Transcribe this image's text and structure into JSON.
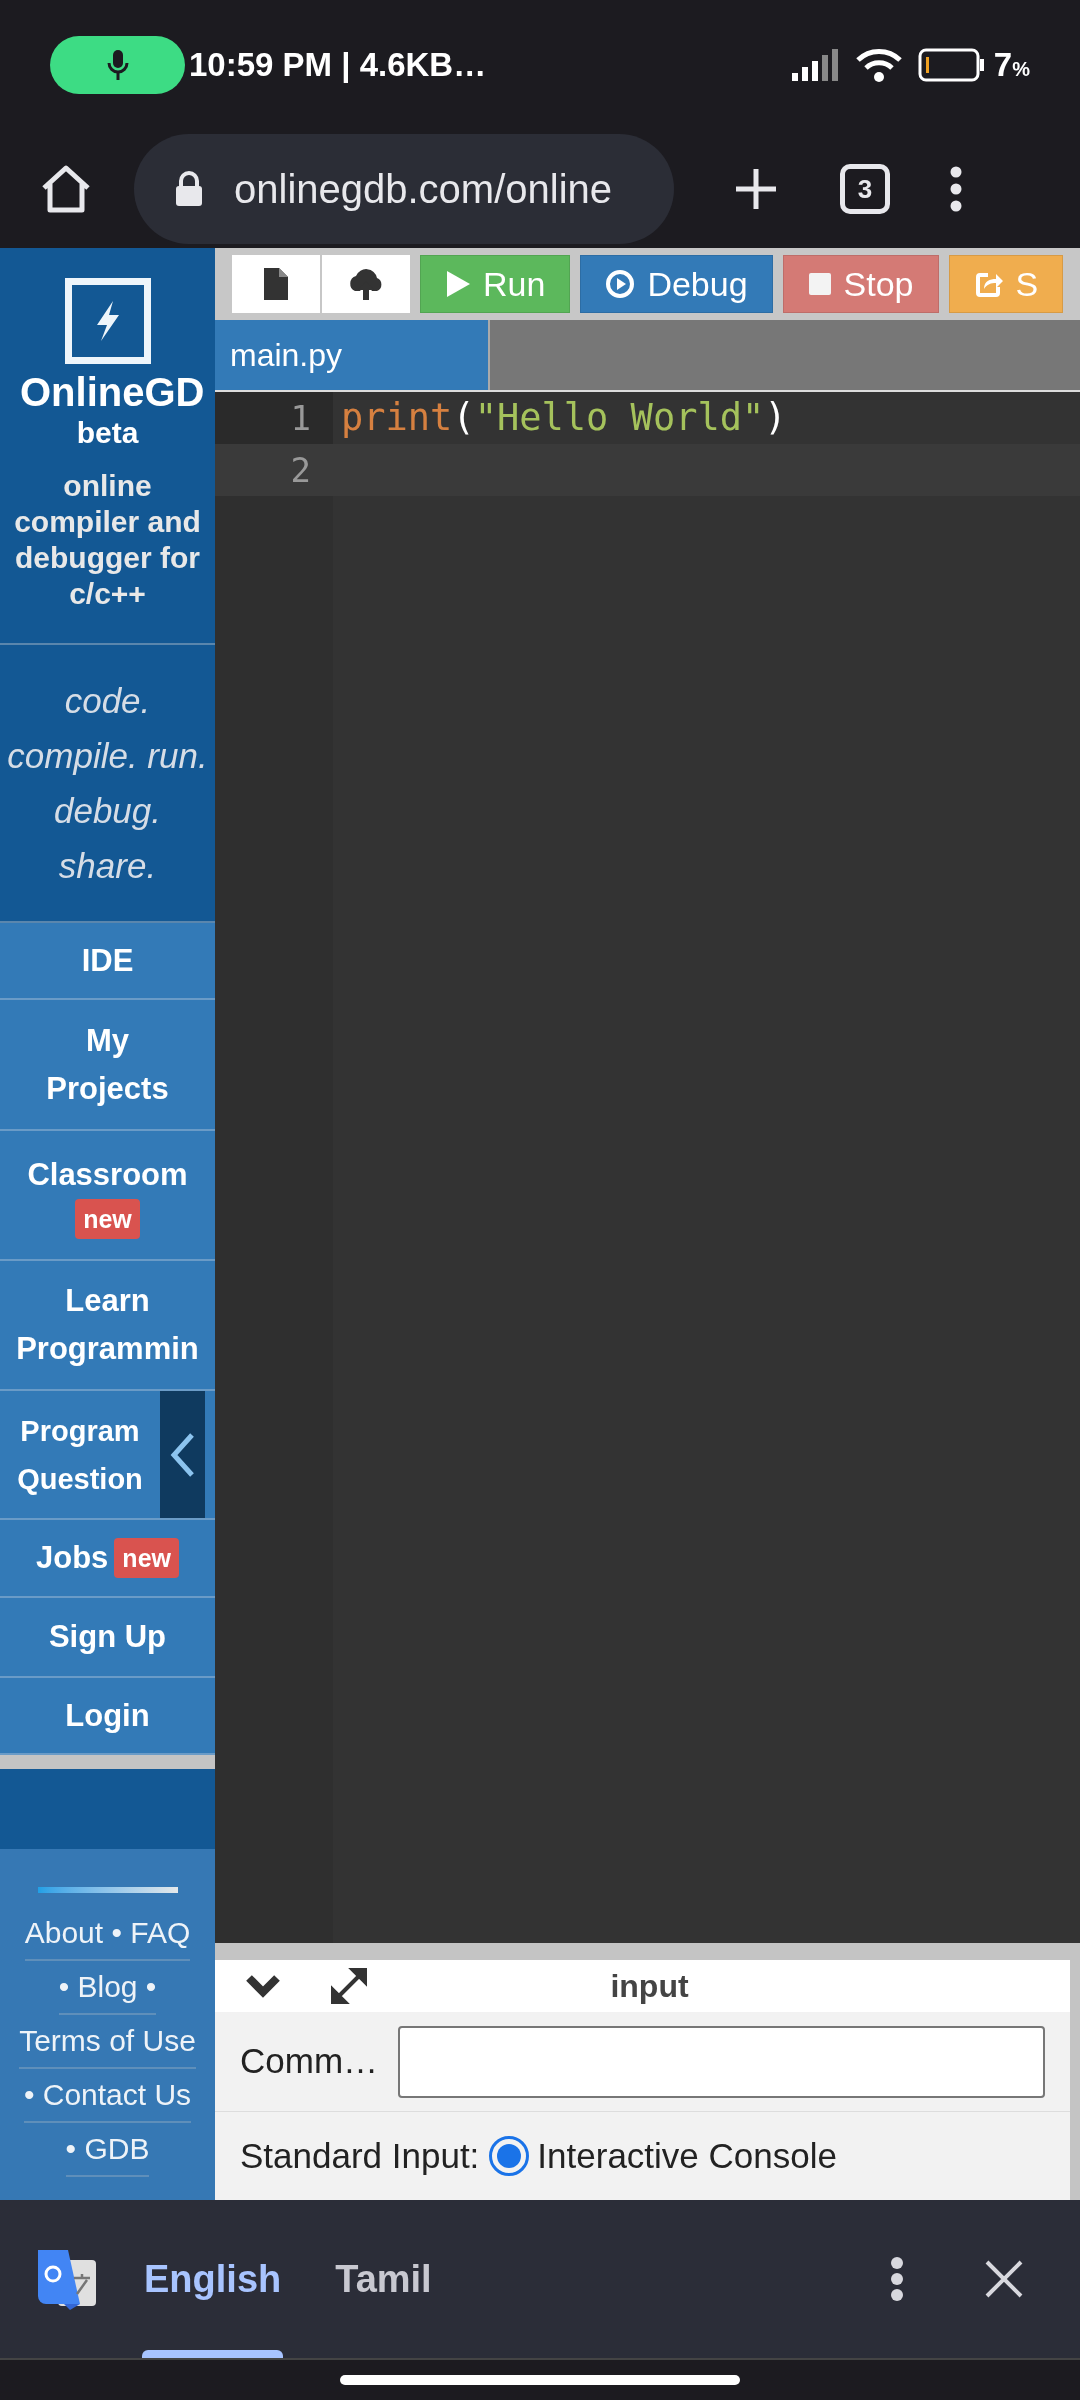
{
  "status_bar": {
    "text": "10:59 PM | 4.6KB…",
    "battery": "7",
    "battery_unit": "%"
  },
  "browser": {
    "url": "onlinegdb.com/online",
    "tab_count": "3"
  },
  "sidebar": {
    "brand": "OnlineGD",
    "badge": "beta",
    "tagline": "online compiler and debugger for c/c++",
    "motto": [
      "code.",
      "compile. run.",
      "debug.",
      "share."
    ],
    "items": [
      {
        "lines": [
          "IDE"
        ]
      },
      {
        "lines": [
          "My",
          "Projects"
        ]
      },
      {
        "lines": [
          "Classroom"
        ],
        "tag": "new",
        "tag_below": true
      },
      {
        "lines": [
          "Learn",
          "Programmin"
        ]
      },
      {
        "lines": [
          "Program",
          "Question"
        ]
      },
      {
        "lines": [
          "Jobs"
        ],
        "tag": "new",
        "tag_below": false
      },
      {
        "lines": [
          "Sign Up"
        ]
      },
      {
        "lines": [
          "Login"
        ]
      }
    ],
    "footer_links": [
      "About • FAQ",
      "• Blog •",
      "Terms of Use",
      "• Contact Us",
      "• GDB"
    ]
  },
  "toolbar": {
    "buttons": [
      {
        "kind": "run",
        "label": "Run"
      },
      {
        "kind": "debug",
        "label": "Debug"
      },
      {
        "kind": "stop",
        "label": "Stop"
      },
      {
        "kind": "share",
        "label": "S"
      }
    ]
  },
  "editor": {
    "tabs": [
      {
        "label": "main.py",
        "selected": true
      }
    ],
    "lines": [
      {
        "number": "1",
        "keyword": "print",
        "open": "(",
        "string": "\"Hello World\"",
        "close": ")",
        "selected": false
      },
      {
        "number": "2",
        "selected": true
      }
    ]
  },
  "input_panel": {
    "title": "input",
    "command_label": "Comm…",
    "standard_input_label": "Standard Input:",
    "options": [
      {
        "label": "Interactive Console",
        "selected": true
      }
    ]
  },
  "translate_bar": {
    "languages": [
      {
        "label": "English",
        "selected": true
      },
      {
        "label": "Tamil",
        "selected": false
      }
    ]
  }
}
